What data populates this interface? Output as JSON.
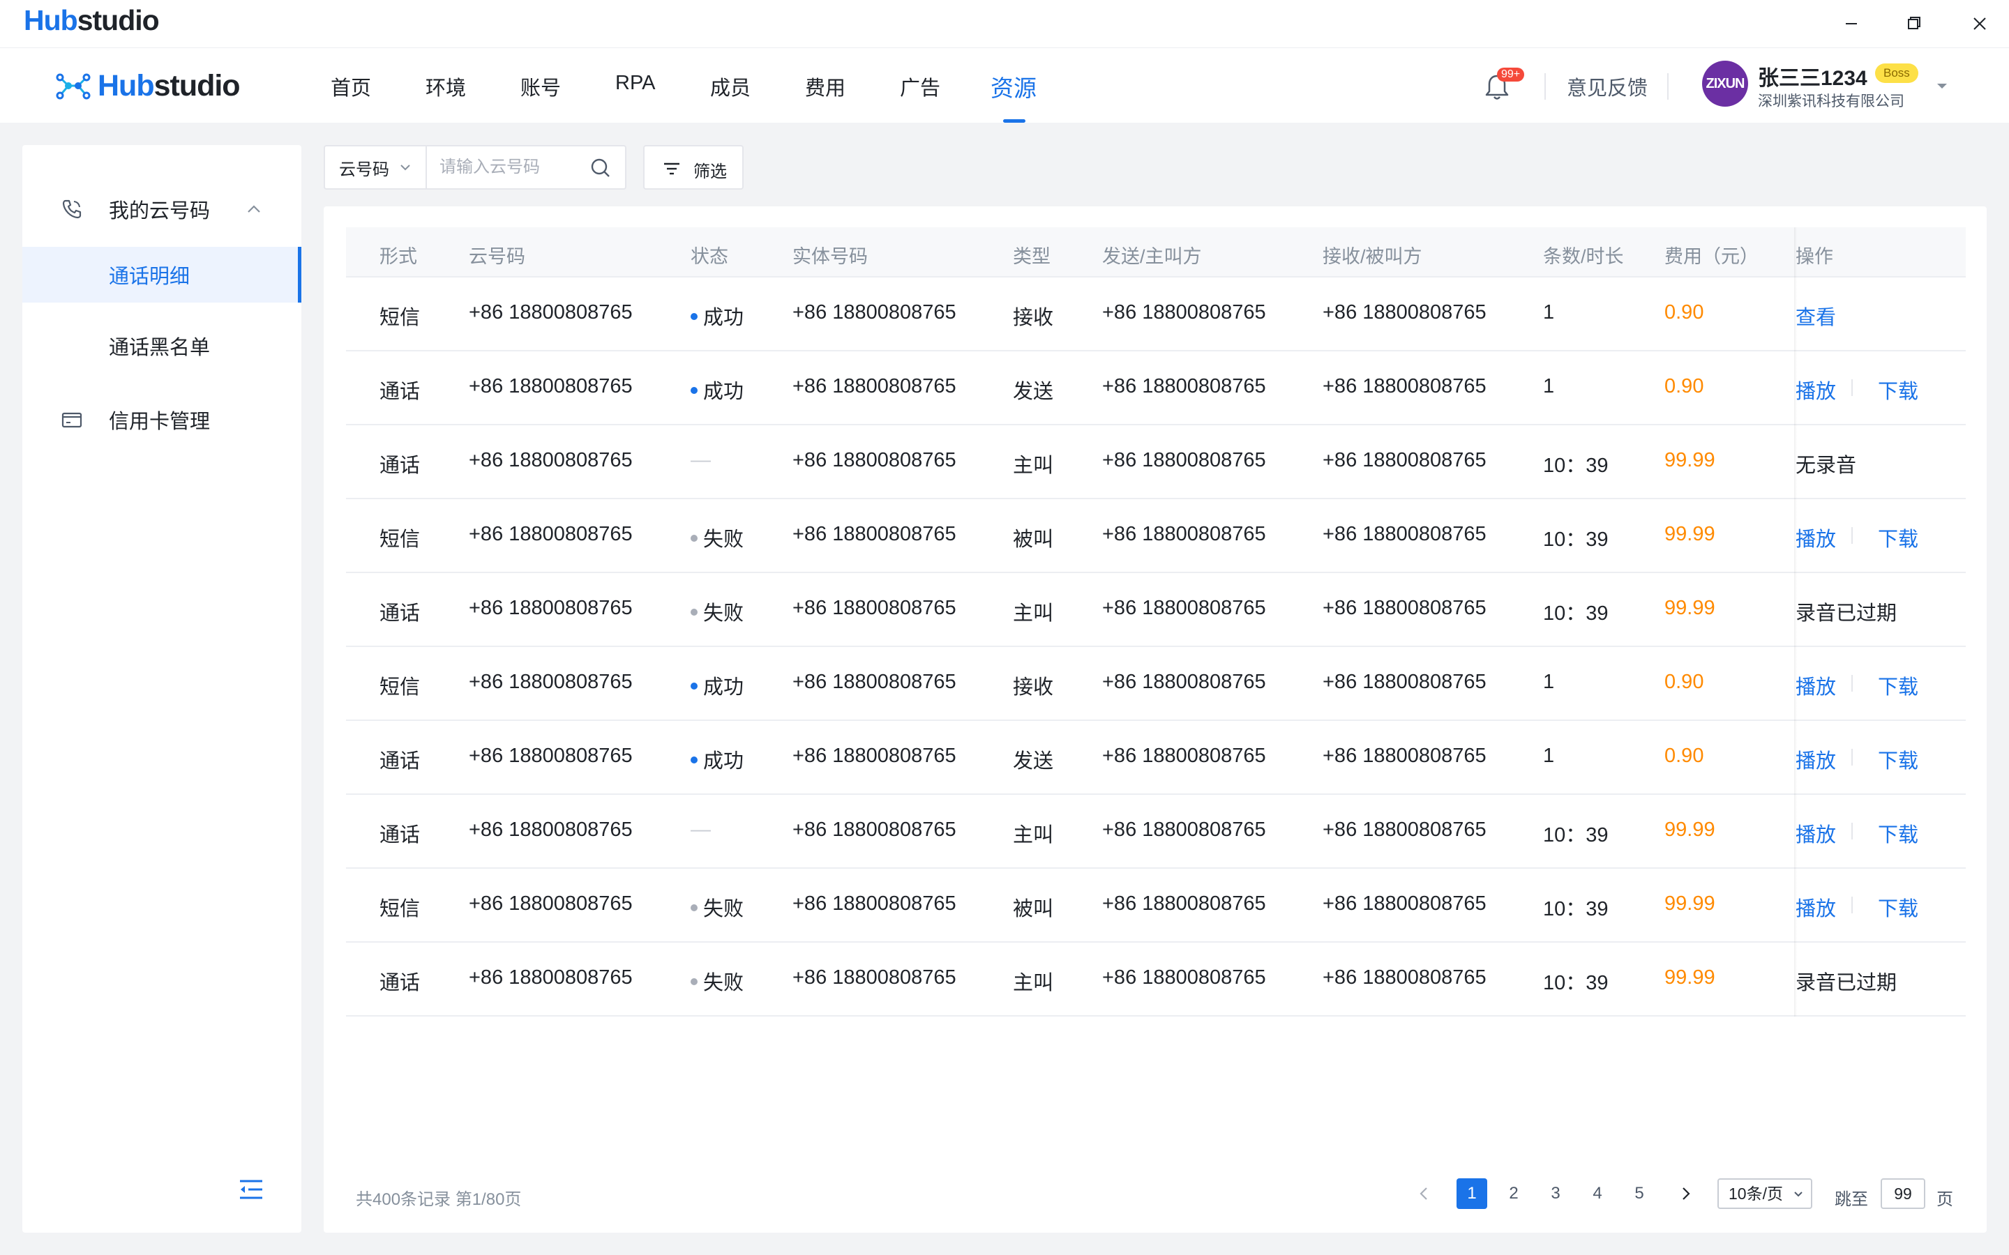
{
  "window": {
    "title_hub": "Hub",
    "title_rest": "studio"
  },
  "nav": {
    "logo_hub": "Hub",
    "logo_rest": "studio",
    "items": [
      {
        "label": "首页"
      },
      {
        "label": "环境"
      },
      {
        "label": "账号"
      },
      {
        "label": "RPA"
      },
      {
        "label": "成员"
      },
      {
        "label": "费用"
      },
      {
        "label": "广告"
      },
      {
        "label": "资源"
      }
    ],
    "active_index": 7,
    "notification_badge": "99+",
    "feedback": "意见反馈",
    "user": {
      "avatar_text": "ZIXUN",
      "name": "张三三1234",
      "role": "Boss",
      "company": "深圳紫讯科技有限公司"
    }
  },
  "sidebar": {
    "group_label": "我的云号码",
    "sub_items": [
      {
        "label": "通话明细"
      },
      {
        "label": "通话黑名单"
      }
    ],
    "active_sub": 0,
    "other_label": "信用卡管理"
  },
  "toolbar": {
    "search_type": "云号码",
    "search_placeholder": "请输入云号码",
    "filter_label": "筛选"
  },
  "table": {
    "columns": [
      "形式",
      "云号码",
      "状态",
      "实体号码",
      "类型",
      "发送/主叫方",
      "接收/被叫方",
      "条数/时长",
      "费用（元）",
      "操作"
    ],
    "rows": [
      {
        "form": "短信",
        "cloud": "+86 18800808765",
        "status": "成功",
        "status_type": "success",
        "real": "+86 18800808765",
        "type": "接收",
        "from": "+86 18800808765",
        "to": "+86 18800808765",
        "count": "1",
        "fee": "0.90",
        "ops": [
          "查看"
        ]
      },
      {
        "form": "通话",
        "cloud": "+86 18800808765",
        "status": "成功",
        "status_type": "success",
        "real": "+86 18800808765",
        "type": "发送",
        "from": "+86 18800808765",
        "to": "+86 18800808765",
        "count": "1",
        "fee": "0.90",
        "ops": [
          "播放",
          "下载"
        ]
      },
      {
        "form": "通话",
        "cloud": "+86 18800808765",
        "status": "—",
        "status_type": "none",
        "real": "+86 18800808765",
        "type": "主叫",
        "from": "+86 18800808765",
        "to": "+86 18800808765",
        "count": "10：39",
        "fee": "99.99",
        "ops_text": "无录音"
      },
      {
        "form": "短信",
        "cloud": "+86 18800808765",
        "status": "失败",
        "status_type": "fail",
        "real": "+86 18800808765",
        "type": "被叫",
        "from": "+86 18800808765",
        "to": "+86 18800808765",
        "count": "10：39",
        "fee": "99.99",
        "ops": [
          "播放",
          "下载"
        ]
      },
      {
        "form": "通话",
        "cloud": "+86 18800808765",
        "status": "失败",
        "status_type": "fail",
        "real": "+86 18800808765",
        "type": "主叫",
        "from": "+86 18800808765",
        "to": "+86 18800808765",
        "count": "10：39",
        "fee": "99.99",
        "ops_text": "录音已过期"
      },
      {
        "form": "短信",
        "cloud": "+86 18800808765",
        "status": "成功",
        "status_type": "success",
        "real": "+86 18800808765",
        "type": "接收",
        "from": "+86 18800808765",
        "to": "+86 18800808765",
        "count": "1",
        "fee": "0.90",
        "ops": [
          "播放",
          "下载"
        ]
      },
      {
        "form": "通话",
        "cloud": "+86 18800808765",
        "status": "成功",
        "status_type": "success",
        "real": "+86 18800808765",
        "type": "发送",
        "from": "+86 18800808765",
        "to": "+86 18800808765",
        "count": "1",
        "fee": "0.90",
        "ops": [
          "播放",
          "下载"
        ]
      },
      {
        "form": "通话",
        "cloud": "+86 18800808765",
        "status": "—",
        "status_type": "none",
        "real": "+86 18800808765",
        "type": "主叫",
        "from": "+86 18800808765",
        "to": "+86 18800808765",
        "count": "10：39",
        "fee": "99.99",
        "ops": [
          "播放",
          "下载"
        ]
      },
      {
        "form": "短信",
        "cloud": "+86 18800808765",
        "status": "失败",
        "status_type": "fail",
        "real": "+86 18800808765",
        "type": "被叫",
        "from": "+86 18800808765",
        "to": "+86 18800808765",
        "count": "10：39",
        "fee": "99.99",
        "ops": [
          "播放",
          "下载"
        ]
      },
      {
        "form": "通话",
        "cloud": "+86 18800808765",
        "status": "失败",
        "status_type": "fail",
        "real": "+86 18800808765",
        "type": "主叫",
        "from": "+86 18800808765",
        "to": "+86 18800808765",
        "count": "10：39",
        "fee": "99.99",
        "ops_text": "录音已过期"
      }
    ]
  },
  "pagination": {
    "total_text": "共400条记录 第1/80页",
    "pages": [
      "1",
      "2",
      "3",
      "4",
      "5"
    ],
    "active_page": "1",
    "page_size": "10条/页",
    "jump_label": "跳至",
    "jump_value": "99",
    "jump_unit": "页"
  },
  "colors": {
    "accent": "#1a73e8",
    "fee": "#ff8a00",
    "success_dot": "#1a73e8",
    "fail_dot": "#a9aeb8",
    "badge": "#f5493a",
    "boss": "#fde047",
    "avatar": "#6b2fa3"
  }
}
